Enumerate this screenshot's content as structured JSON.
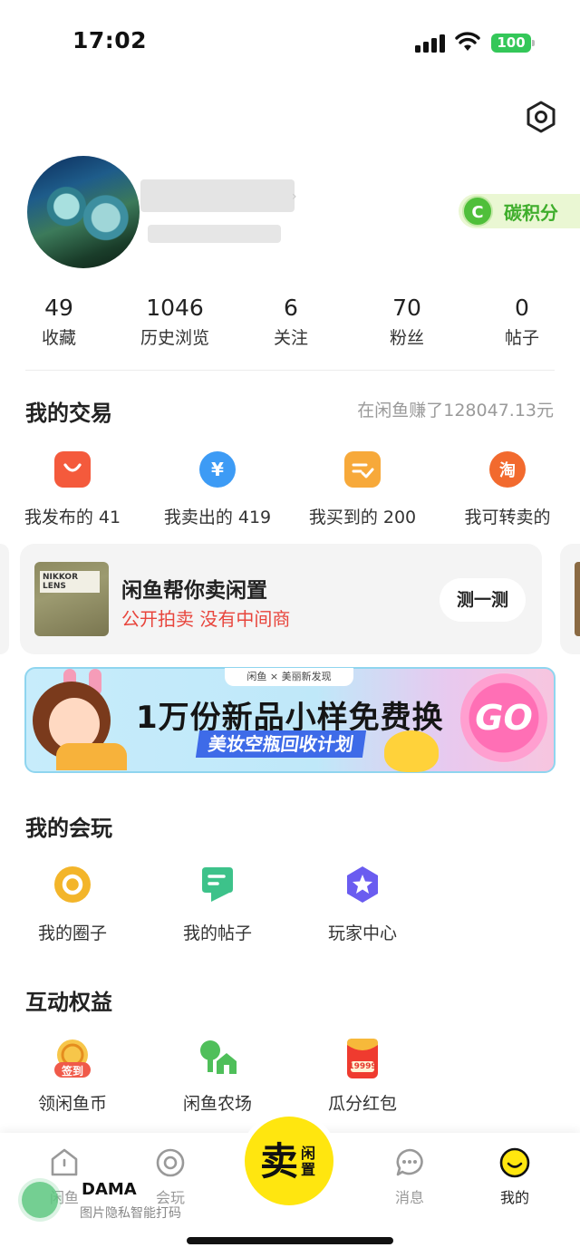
{
  "status_bar": {
    "time": "17:02",
    "battery": "100"
  },
  "profile": {
    "carbon_logo": "C",
    "carbon_label": "碳积分"
  },
  "stats": [
    {
      "value": "49",
      "label": "收藏"
    },
    {
      "value": "1046",
      "label": "历史浏览"
    },
    {
      "value": "6",
      "label": "关注"
    },
    {
      "value": "70",
      "label": "粉丝"
    },
    {
      "value": "0",
      "label": "帖子"
    }
  ],
  "trade": {
    "title": "我的交易",
    "earned": "在闲鱼赚了128047.13元",
    "actions": [
      {
        "label": "我发布的 41",
        "icon": "bag-icon",
        "color": "#f45a3c"
      },
      {
        "label": "我卖出的 419",
        "icon": "yen-icon",
        "color": "#3d9bf5"
      },
      {
        "label": "我买到的 200",
        "icon": "receipt-icon",
        "color": "#f7a93a"
      },
      {
        "label": "我可转卖的",
        "icon": "taobao-icon",
        "color": "#f26a2e",
        "glyph": "淘"
      }
    ]
  },
  "sell_card": {
    "thumb_text": "NIKKOR LENS",
    "title": "闲鱼帮你卖闲置",
    "subtitle": "公开拍卖 没有中间商",
    "button": "测一测"
  },
  "banner": {
    "top_label": "闲鱼 × 美丽新发现",
    "main_text": "1万份新品小样免费换",
    "sub_text": "美妆空瓶回收计划",
    "go_text": "GO"
  },
  "play": {
    "title": "我的会玩",
    "items": [
      {
        "label": "我的圈子",
        "icon": "circle-ring-icon",
        "color": "#f3b52a"
      },
      {
        "label": "我的帖子",
        "icon": "post-icon",
        "color": "#3dc28a"
      },
      {
        "label": "玩家中心",
        "icon": "star-badge-icon",
        "color": "#6a5cf0"
      }
    ]
  },
  "rights": {
    "title": "互动权益",
    "items": [
      {
        "label": "领闲鱼币",
        "icon": "coin-signin-icon",
        "badge": "签到"
      },
      {
        "label": "闲鱼农场",
        "icon": "farm-icon"
      },
      {
        "label": "瓜分红包",
        "icon": "red-packet-icon",
        "badge": "19999"
      }
    ]
  },
  "tabbar": {
    "tabs": [
      {
        "label": "闲鱼"
      },
      {
        "label": "会玩"
      },
      {
        "label": "消息"
      },
      {
        "label": "我的"
      }
    ],
    "sell_big": "卖",
    "sell_small_1": "闲",
    "sell_small_2": "置"
  },
  "watermark": {
    "title": "DAMA",
    "subtitle": "图片隐私智能打码"
  }
}
